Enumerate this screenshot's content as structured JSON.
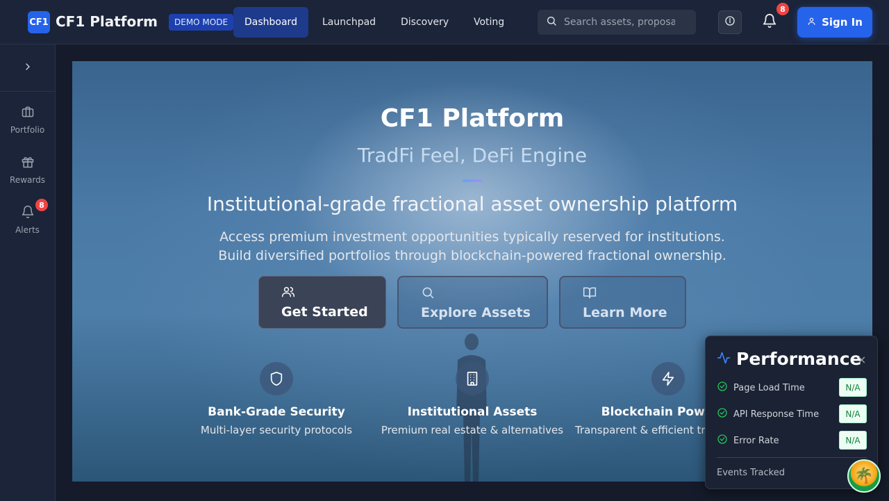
{
  "header": {
    "logo_text": "CF1",
    "brand": "CF1 Platform",
    "demo_badge": "DEMO MODE",
    "nav": [
      {
        "label": "Dashboard",
        "active": true
      },
      {
        "label": "Launchpad"
      },
      {
        "label": "Discovery"
      },
      {
        "label": "Voting"
      }
    ],
    "search_placeholder": "Search assets, proposals...",
    "notification_count": "8",
    "sign_in": "Sign In"
  },
  "sidebar": {
    "items": [
      {
        "label": "Portfolio",
        "icon": "briefcase-icon"
      },
      {
        "label": "Rewards",
        "icon": "gift-icon"
      },
      {
        "label": "Alerts",
        "icon": "bell-icon",
        "badge": "8"
      }
    ]
  },
  "hero": {
    "title": "CF1 Platform",
    "subtitle": "TradFi Feel, DeFi Engine",
    "tagline": "Institutional-grade fractional asset ownership platform",
    "desc_line1": "Access premium investment opportunities typically reserved for institutions.",
    "desc_line2": "Build diversified portfolios through blockchain-powered fractional ownership.",
    "ctas": [
      {
        "label": "Get Started",
        "icon": "users-icon"
      },
      {
        "label": "Explore Assets",
        "icon": "search-icon"
      },
      {
        "label": "Learn More",
        "icon": "book-icon"
      }
    ],
    "features": [
      {
        "title": "Bank-Grade Security",
        "text": "Multi-layer security protocols",
        "icon": "shield-icon"
      },
      {
        "title": "Institutional Assets",
        "text": "Premium real estate & alternatives",
        "icon": "building-icon"
      },
      {
        "title": "Blockchain Powered",
        "text": "Transparent & efficient transactions",
        "icon": "lightning-icon"
      }
    ]
  },
  "performance": {
    "title": "Performance",
    "close": "×",
    "metrics": [
      {
        "label": "Page Load Time",
        "value": "N/A"
      },
      {
        "label": "API Response Time",
        "value": "N/A"
      },
      {
        "label": "Error Rate",
        "value": "N/A"
      }
    ],
    "events_label": "Events Tracked"
  },
  "colors": {
    "accent": "#2563eb",
    "badge": "#ef4444",
    "success": "#22c55e"
  }
}
